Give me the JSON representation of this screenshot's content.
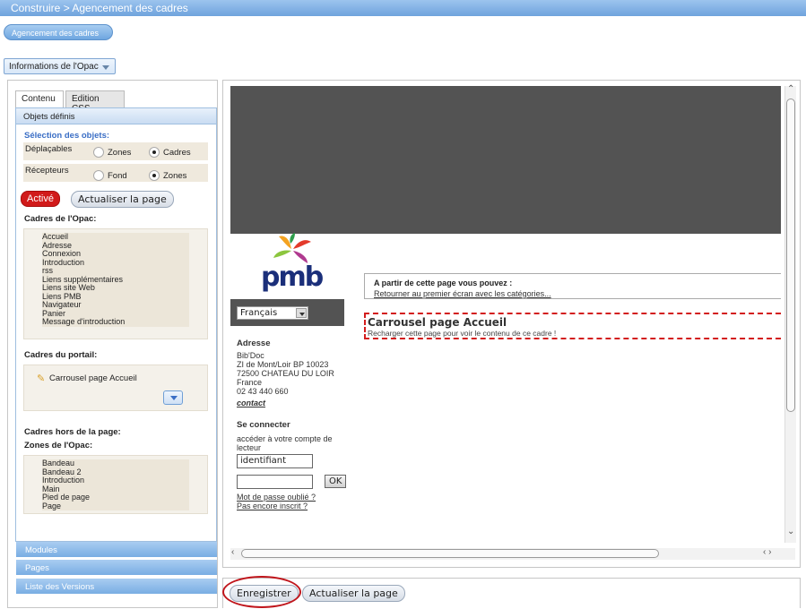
{
  "header": {
    "breadcrumb": "Construire > Agencement des cadres",
    "pill": "Agencement des cadres"
  },
  "opac_select": {
    "value": "Informations de l'Opac"
  },
  "tabs": [
    {
      "label": "Contenu",
      "active": true
    },
    {
      "label": "Edition CSS",
      "active": false
    }
  ],
  "objets": {
    "header": "Objets définis",
    "selection_title": "Sélection des objets:",
    "deplacables": {
      "label": "Déplaçables",
      "options": [
        "Zones",
        "Cadres"
      ],
      "selected": "Cadres"
    },
    "recepteurs": {
      "label": "Récepteurs",
      "options": [
        "Fond",
        "Zones"
      ],
      "selected": "Zones"
    },
    "active_button": "Activé",
    "refresh_button": "Actualiser la page"
  },
  "cadres_opac": {
    "title": "Cadres de l'Opac:",
    "items": [
      "Accueil",
      "Adresse",
      "Connexion",
      "Introduction",
      "rss",
      "Liens supplémentaires",
      "Liens site Web",
      "Liens PMB",
      "Navigateur",
      "Panier",
      "Message d'introduction"
    ]
  },
  "cadres_portail": {
    "title": "Cadres du portail:",
    "item": "Carrousel page Accueil"
  },
  "hors_page": {
    "title": "Cadres hors de la page:",
    "zones_title": "Zones de l'Opac:",
    "zones": [
      "Bandeau",
      "Bandeau 2",
      "Introduction",
      "Main",
      "Pied de page",
      "Page"
    ]
  },
  "accordion": [
    "Modules",
    "Pages",
    "Liste des Versions"
  ],
  "preview": {
    "logo_text": "pmb",
    "language": "Français",
    "adresse_title": "Adresse",
    "adresse_lines": [
      "Bib'Doc",
      "ZI de Mont/Loir BP 10023",
      "72500 CHATEAU DU LOIR",
      "France",
      "02 43 440 660"
    ],
    "contact_link": "contact",
    "connect_title": "Se connecter",
    "connect_text": "accéder à votre compte de lecteur",
    "login_placeholder": "identifiant",
    "ok_button": "OK",
    "forgot_link": "Mot de passe oublié ?",
    "register_link": "Pas encore inscrit ?",
    "options_title": "A partir de cette page vous pouvez :",
    "options_link": "Retourner au premier écran avec les catégories...",
    "carousel_title": "Carrousel page Accueil",
    "carousel_text": "Recharger cette page pour voir le contenu de ce cadre !"
  },
  "footer": {
    "save_button": "Enregistrer",
    "refresh_button": "Actualiser la page"
  },
  "colors": {
    "accent": "#79ade3",
    "active_red": "#d11a1a",
    "highlight_ring": "#c0151b",
    "banner": "#535353"
  }
}
